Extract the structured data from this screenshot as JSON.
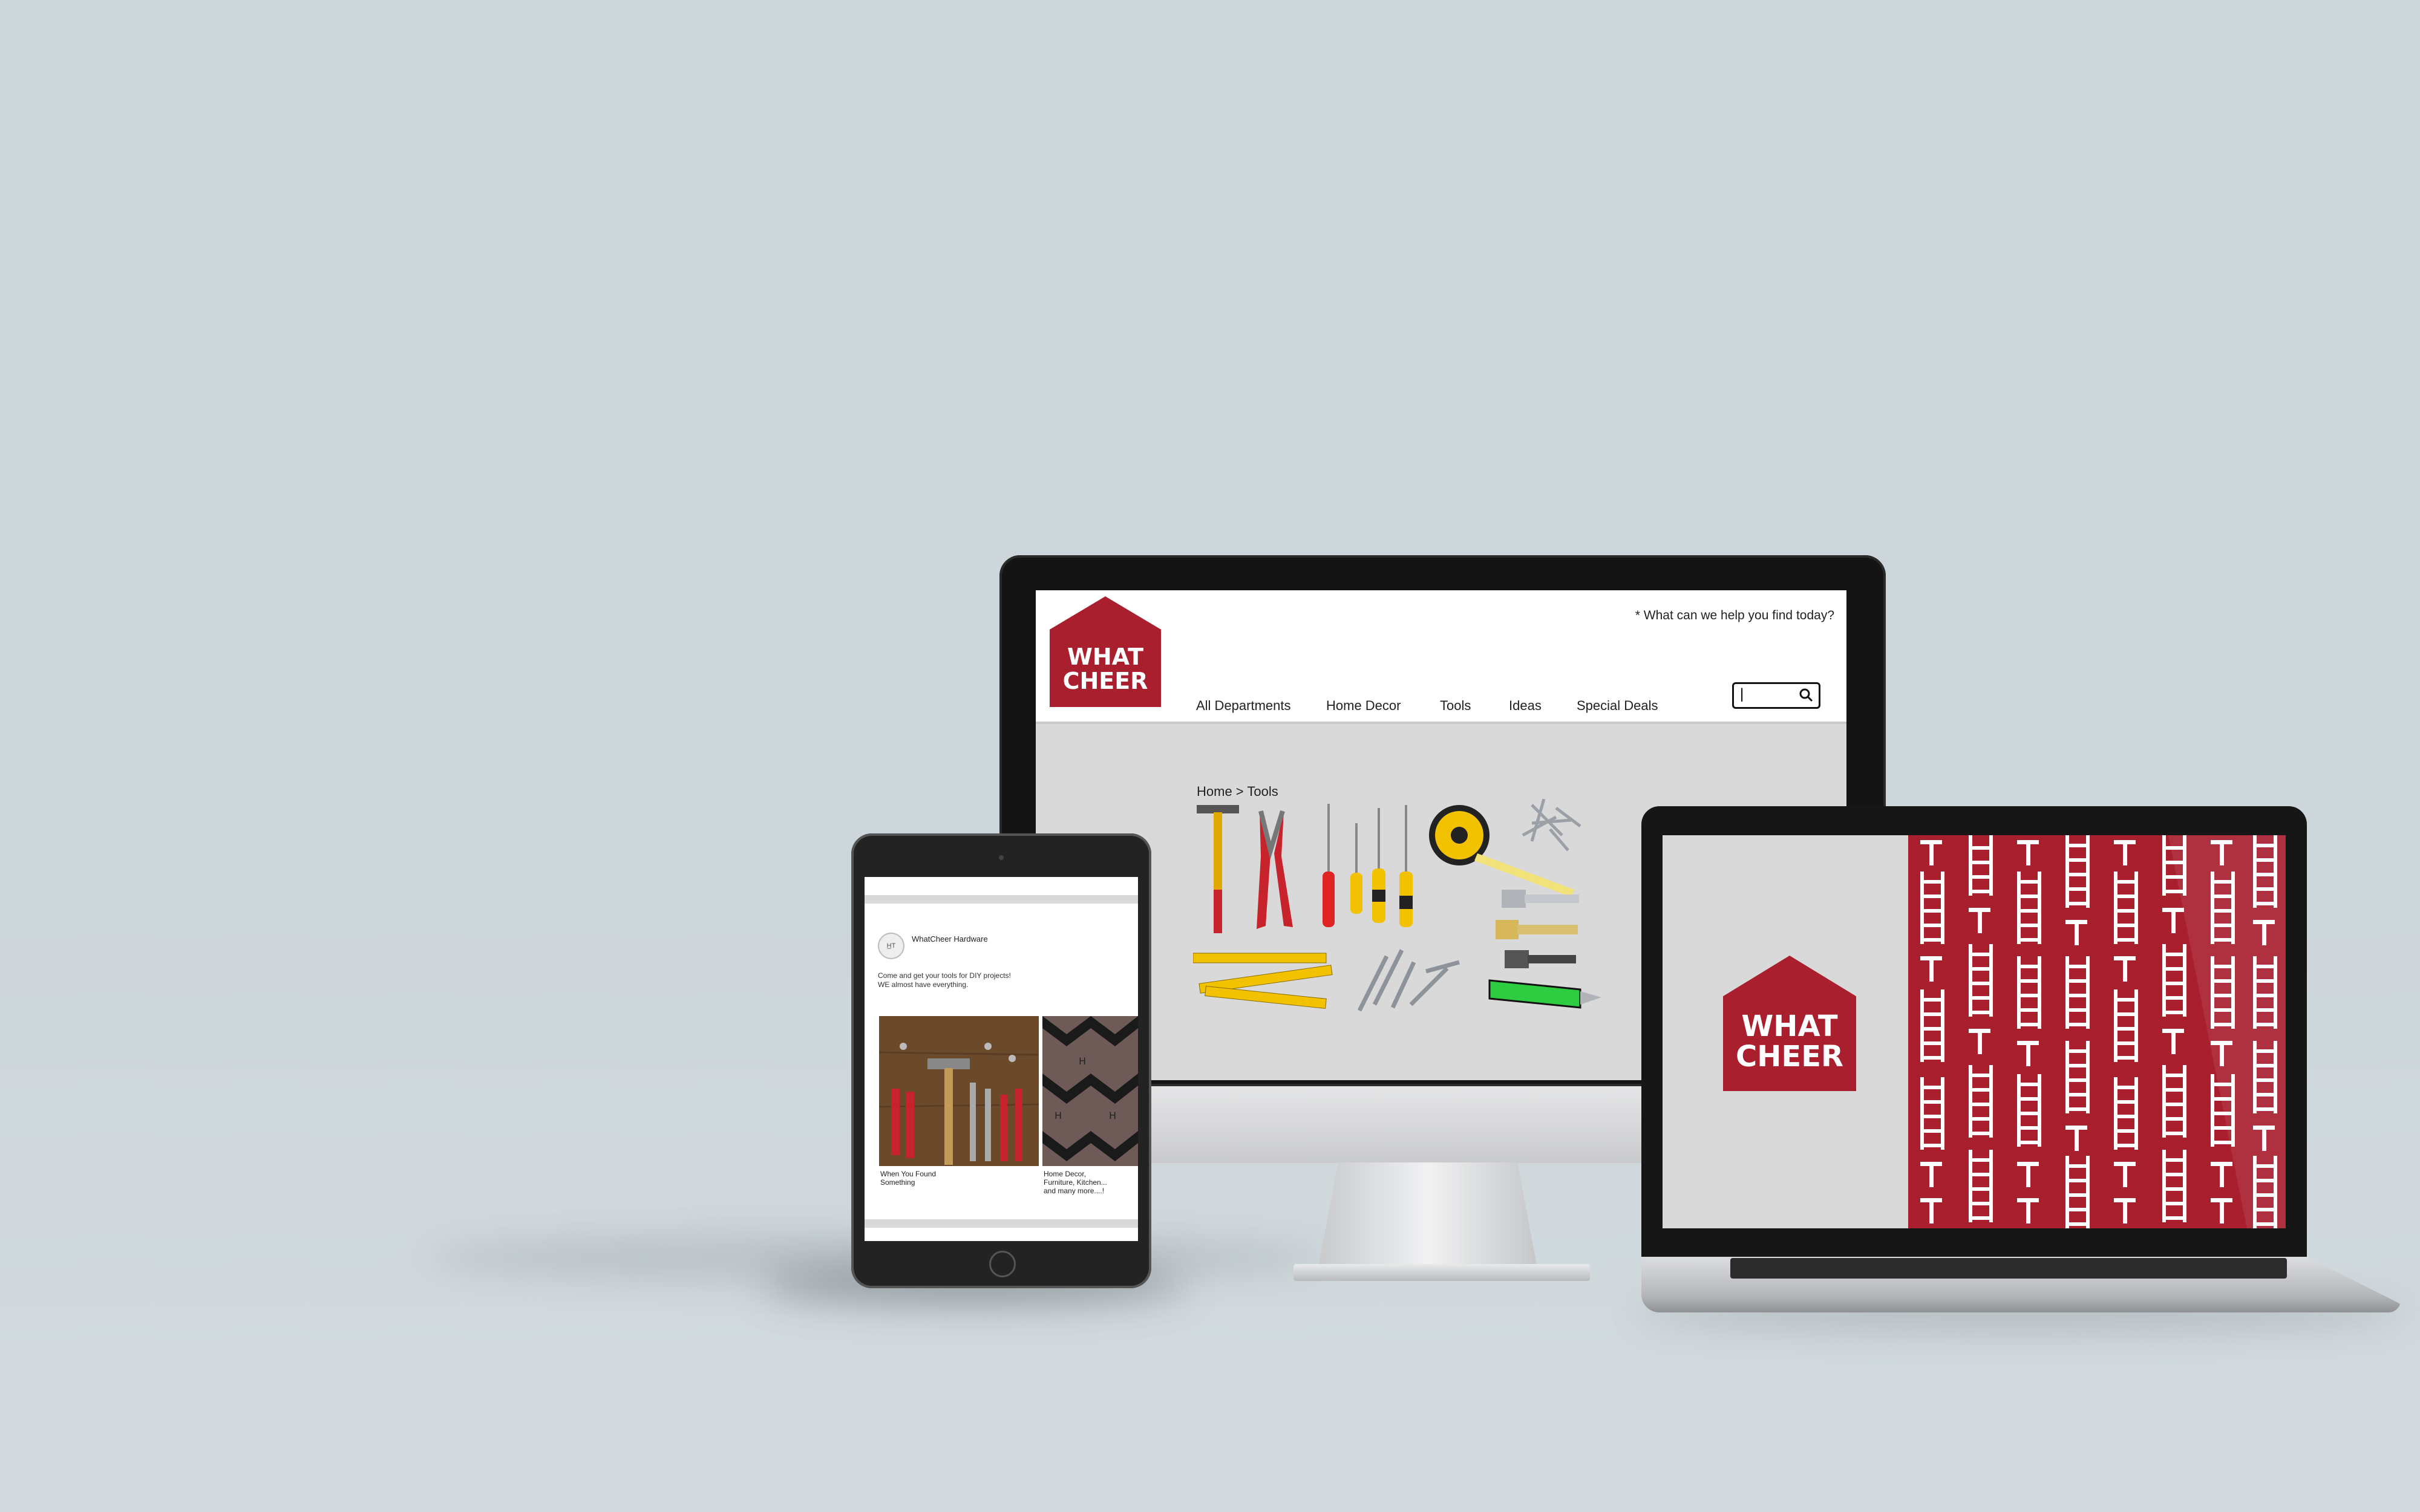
{
  "colors": {
    "brand_red": "#a91f2e",
    "background": "#cdd6da",
    "device_dark": "#161616"
  },
  "desktop_site": {
    "logo": {
      "line1": "WHAT",
      "line2": "CHEER"
    },
    "help_text": "* What can we help you find today?",
    "nav": [
      "All Departments",
      "Home Decor",
      "Tools",
      "Ideas",
      "Special Deals"
    ],
    "search": {
      "value": "|",
      "icon": "search-icon"
    },
    "breadcrumb": "Home > Tools"
  },
  "tablet_post": {
    "page_name": "WhatCheer Hardware",
    "caption_line1": "Come and get your tools for DIY projects!",
    "caption_line2": "WE almost have everything.",
    "cards": [
      {
        "line1": "When You Found",
        "line2": "Something"
      },
      {
        "line1": "Home Decor,",
        "line2": "Furniture, Kitchen...",
        "line3": "and many more....!"
      }
    ]
  },
  "laptop_site": {
    "logo": {
      "line1": "WHAT",
      "line2": "CHEER"
    }
  }
}
